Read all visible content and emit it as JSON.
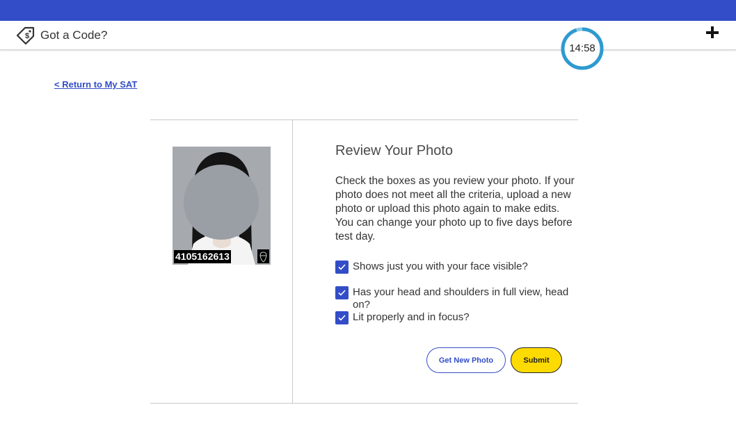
{
  "header": {
    "code_label": "Got a Code?",
    "code_icon": "coupon-tag-icon",
    "expand_icon": "plus-icon",
    "timer_text": "14:58",
    "timer_progress": 0.95,
    "accent_color": "#324dc7",
    "timer_ring_color": "#2e9ad0"
  },
  "nav": {
    "return_link": "< Return to My SAT"
  },
  "photo": {
    "id_number": "4105162613",
    "badge_icon": "acorn-icon"
  },
  "review": {
    "title": "Review Your Photo",
    "description": "Check the boxes as you review your photo. If your photo does not meet all the criteria, upload a new photo or upload this photo again to make edits. You can change your photo up to five days before test day.",
    "checks": [
      {
        "label": "Shows just you with your face visible?",
        "checked": true
      },
      {
        "label": "Has your head and shoulders in full view, head on?",
        "checked": true
      },
      {
        "label": "Lit properly and in focus?",
        "checked": true
      }
    ]
  },
  "actions": {
    "get_new_photo": "Get New Photo",
    "submit": "Submit",
    "submit_color": "#fedb00"
  }
}
